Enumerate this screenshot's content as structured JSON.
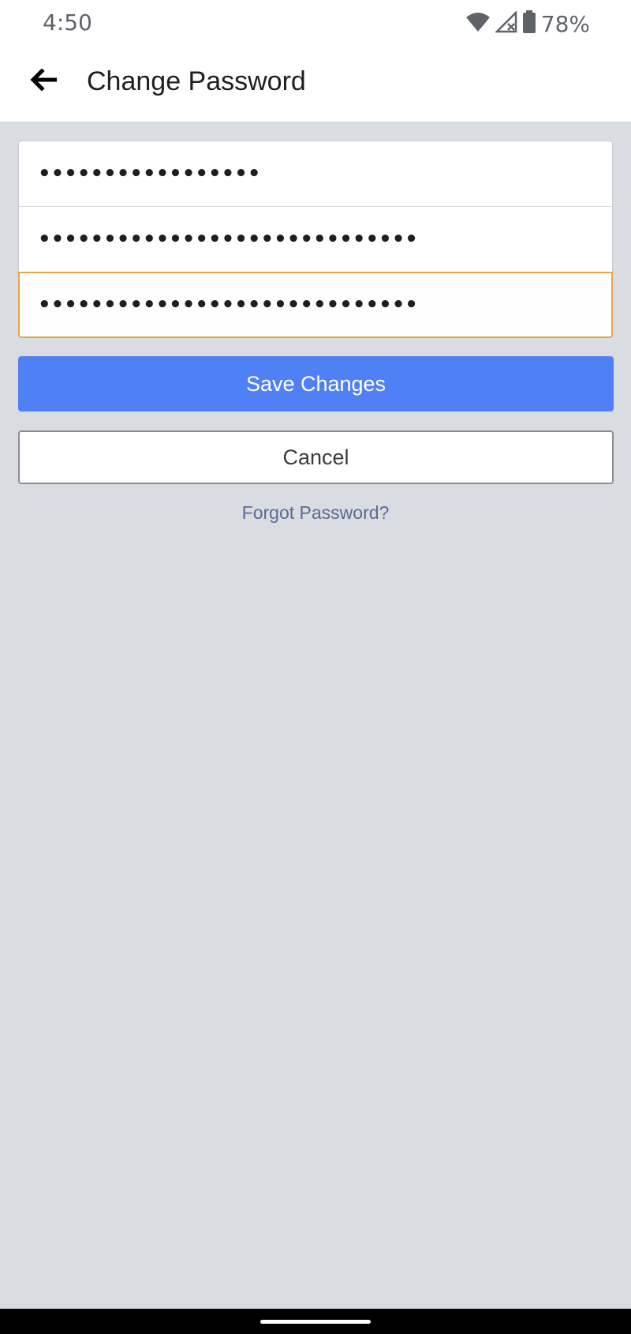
{
  "status_bar": {
    "time": "4:50",
    "battery_percent": "78%",
    "icons": [
      "wifi-icon",
      "cellular-no-signal-icon",
      "battery-icon"
    ]
  },
  "app_bar": {
    "title": "Change Password",
    "back_icon": "arrow-left-icon"
  },
  "form": {
    "fields": [
      {
        "name": "current-password",
        "masked_value": "•••••••••••••••••",
        "focused": false
      },
      {
        "name": "new-password",
        "masked_value": "•••••••••••••••••••••••••••••",
        "focused": false
      },
      {
        "name": "confirm-password",
        "masked_value": "•••••••••••••••••••••••••••••",
        "focused": true
      }
    ],
    "save_label": "Save Changes",
    "cancel_label": "Cancel",
    "forgot_label": "Forgot Password?"
  },
  "colors": {
    "primary_button": "#5080f5",
    "focus_border": "#e3a649",
    "link": "#5b6a96",
    "background": "#d9dce0"
  }
}
